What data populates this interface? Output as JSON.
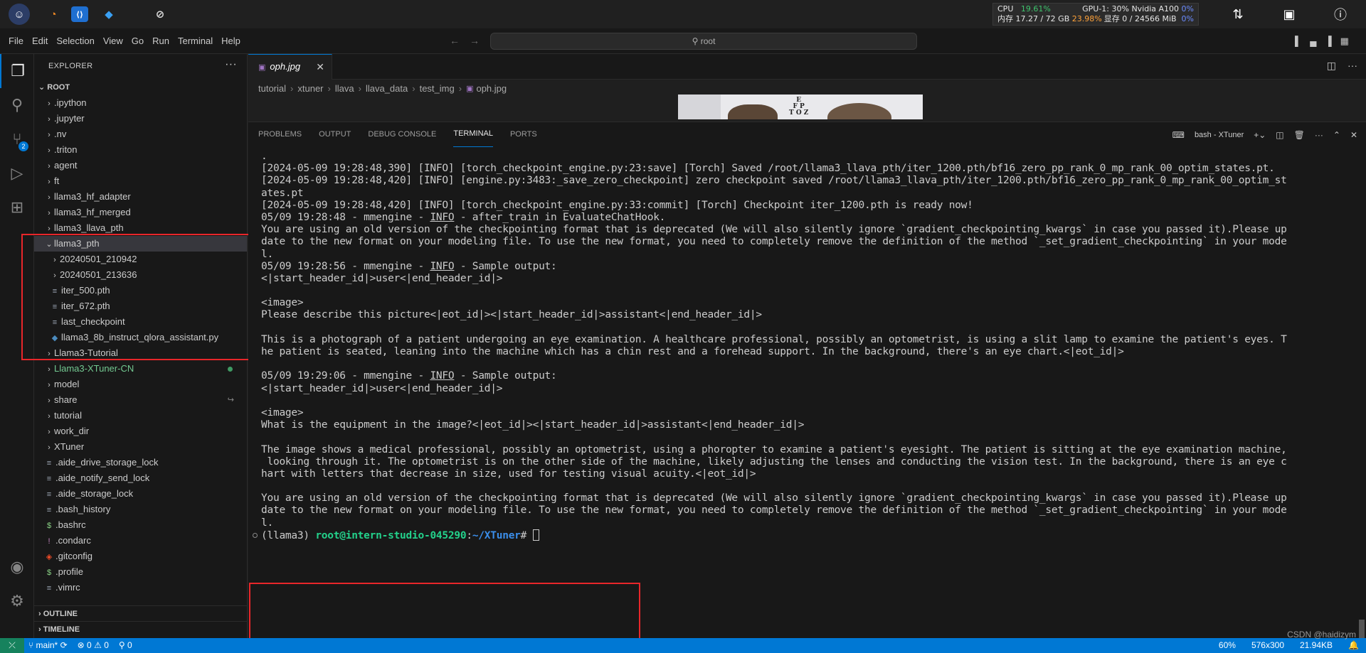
{
  "taskbar": {
    "cpu_label": "CPU",
    "cpu_value": "19.61%",
    "mem_label": "内存 17.27 / 72 GB",
    "mem_value": "23.98%",
    "gpu_label": "GPU-1: 30% Nvidia A100",
    "gpu_value": "0%",
    "vram_label": "显存 0 / 24566 MiB",
    "vram_value": "0%"
  },
  "menubar": {
    "items": [
      "File",
      "Edit",
      "Selection",
      "View",
      "Go",
      "Run",
      "Terminal",
      "Help"
    ],
    "search_text": "root"
  },
  "activity": {
    "scm_badge": "2"
  },
  "explorer": {
    "title": "EXPLORER",
    "root": "ROOT",
    "items": [
      {
        "label": ".ipython",
        "type": "folder",
        "depth": 0
      },
      {
        "label": ".jupyter",
        "type": "folder",
        "depth": 0
      },
      {
        "label": ".nv",
        "type": "folder",
        "depth": 0
      },
      {
        "label": ".triton",
        "type": "folder",
        "depth": 0
      },
      {
        "label": "agent",
        "type": "folder",
        "depth": 0
      },
      {
        "label": "ft",
        "type": "folder",
        "depth": 0
      },
      {
        "label": "llama3_hf_adapter",
        "type": "folder",
        "depth": 0
      },
      {
        "label": "llama3_hf_merged",
        "type": "folder",
        "depth": 0
      },
      {
        "label": "llama3_llava_pth",
        "type": "folder",
        "depth": 0
      },
      {
        "label": "llama3_pth",
        "type": "folder-open",
        "depth": 0
      },
      {
        "label": "20240501_210942",
        "type": "folder",
        "depth": 1
      },
      {
        "label": "20240501_213636",
        "type": "folder",
        "depth": 1
      },
      {
        "label": "iter_500.pth",
        "type": "file",
        "depth": 1
      },
      {
        "label": "iter_672.pth",
        "type": "file",
        "depth": 1
      },
      {
        "label": "last_checkpoint",
        "type": "file",
        "depth": 1
      },
      {
        "label": "llama3_8b_instruct_qlora_assistant.py",
        "type": "python",
        "depth": 1
      },
      {
        "label": "Llama3-Tutorial",
        "type": "folder",
        "depth": 0
      },
      {
        "label": "Llama3-XTuner-CN",
        "type": "folder-git",
        "depth": 0
      },
      {
        "label": "model",
        "type": "folder",
        "depth": 0
      },
      {
        "label": "share",
        "type": "folder-link",
        "depth": 0
      },
      {
        "label": "tutorial",
        "type": "folder",
        "depth": 0
      },
      {
        "label": "work_dir",
        "type": "folder",
        "depth": 0
      },
      {
        "label": "XTuner",
        "type": "folder",
        "depth": 0
      },
      {
        "label": ".aide_drive_storage_lock",
        "type": "file",
        "depth": 0
      },
      {
        "label": ".aide_notify_send_lock",
        "type": "file",
        "depth": 0
      },
      {
        "label": ".aide_storage_lock",
        "type": "file",
        "depth": 0
      },
      {
        "label": ".bash_history",
        "type": "file",
        "depth": 0
      },
      {
        "label": ".bashrc",
        "type": "shell",
        "depth": 0
      },
      {
        "label": ".condarc",
        "type": "config",
        "depth": 0
      },
      {
        "label": ".gitconfig",
        "type": "git",
        "depth": 0
      },
      {
        "label": ".profile",
        "type": "shell",
        "depth": 0
      },
      {
        "label": ".vimrc",
        "type": "file",
        "depth": 0
      }
    ],
    "outline": "OUTLINE",
    "timeline": "TIMELINE"
  },
  "editor": {
    "tab_label": "oph.jpg",
    "breadcrumb": [
      "tutorial",
      "xtuner",
      "llava",
      "llava_data",
      "test_img",
      "oph.jpg"
    ],
    "eye_chart_text": "E\nF P\nT O Z"
  },
  "panel": {
    "tabs": [
      "PROBLEMS",
      "OUTPUT",
      "DEBUG CONSOLE",
      "TERMINAL",
      "PORTS"
    ],
    "active_tab": "TERMINAL",
    "terminal_name": "bash - XTuner"
  },
  "terminal": {
    "lines": [
      ".",
      "[2024-05-09 19:28:48,390] [INFO] [torch_checkpoint_engine.py:23:save] [Torch] Saved /root/llama3_llava_pth/iter_1200.pth/bf16_zero_pp_rank_0_mp_rank_00_optim_states.pt.",
      "[2024-05-09 19:28:48,420] [INFO] [engine.py:3483:_save_zero_checkpoint] zero checkpoint saved /root/llama3_llava_pth/iter_1200.pth/bf16_zero_pp_rank_0_mp_rank_00_optim_st",
      "ates.pt",
      "[2024-05-09 19:28:48,420] [INFO] [torch_checkpoint_engine.py:33:commit] [Torch] Checkpoint iter_1200.pth is ready now!",
      "05/09 19:28:48 - mmengine - |INFO| - after_train in EvaluateChatHook.",
      "You are using an old version of the checkpointing format that is deprecated (We will also silently ignore `gradient_checkpointing_kwargs` in case you passed it).Please up",
      "date to the new format on your modeling file. To use the new format, you need to completely remove the definition of the method `_set_gradient_checkpointing` in your mode",
      "l.",
      "05/09 19:28:56 - mmengine - |INFO| - Sample output:",
      "<|start_header_id|>user<|end_header_id|>",
      "",
      "<image>",
      "Please describe this picture<|eot_id|><|start_header_id|>assistant<|end_header_id|>",
      "",
      "This is a photograph of a patient undergoing an eye examination. A healthcare professional, possibly an optometrist, is using a slit lamp to examine the patient's eyes. T",
      "he patient is seated, leaning into the machine which has a chin rest and a forehead support. In the background, there's an eye chart.<|eot_id|>",
      "",
      "05/09 19:29:06 - mmengine - |INFO| - Sample output:",
      "<|start_header_id|>user<|end_header_id|>",
      "",
      "<image>",
      "What is the equipment in the image?<|eot_id|><|start_header_id|>assistant<|end_header_id|>",
      "",
      "The image shows a medical professional, possibly an optometrist, using a phoropter to examine a patient's eyesight. The patient is sitting at the eye examination machine,",
      " looking through it. The optometrist is on the other side of the machine, likely adjusting the lenses and conducting the vision test. In the background, there is an eye c",
      "hart with letters that decrease in size, used for testing visual acuity.<|eot_id|>",
      "",
      "You are using an old version of the checkpointing format that is deprecated (We will also silently ignore `gradient_checkpointing_kwargs` in case you passed it).Please up",
      "date to the new format on your modeling file. To use the new format, you need to completely remove the definition of the method `_set_gradient_checkpointing` in your mode",
      "l."
    ],
    "prompt_env": "(llama3) ",
    "prompt_user": "root@intern-studio-045290",
    "prompt_sep": ":",
    "prompt_path": "~/XTuner",
    "prompt_char": "# "
  },
  "statusbar": {
    "branch": "main*",
    "errors": "0",
    "warnings": "0",
    "ports": "0",
    "zoom": "60%",
    "dimensions": "576x300",
    "filesize": "21.94KB"
  },
  "watermark": "CSDN @haidizym"
}
